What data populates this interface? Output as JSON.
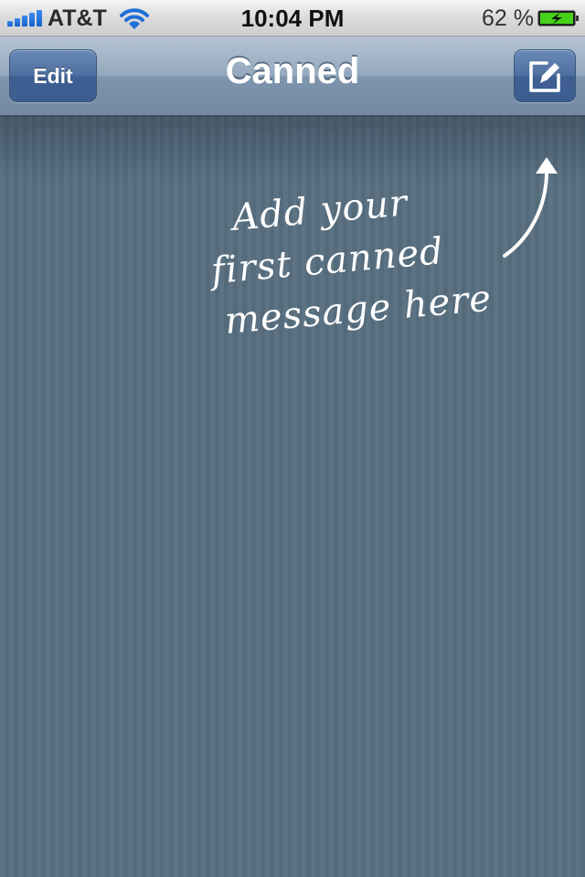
{
  "status_bar": {
    "carrier": "AT&T",
    "time": "10:04 PM",
    "battery_percent": "62 %",
    "signal_icon": "signal-bars-icon",
    "wifi_icon": "wifi-icon",
    "battery_icon": "battery-charging-icon"
  },
  "nav_bar": {
    "title": "Canned",
    "edit_label": "Edit",
    "compose_icon": "compose-icon"
  },
  "empty_state": {
    "line1": "Add your",
    "line2": "first canned",
    "line3": "message here",
    "arrow_icon": "curved-arrow-up-icon"
  },
  "colors": {
    "background": "#576e80",
    "nav_button": "#4a6a9c",
    "battery_fill": "#46d11a"
  }
}
